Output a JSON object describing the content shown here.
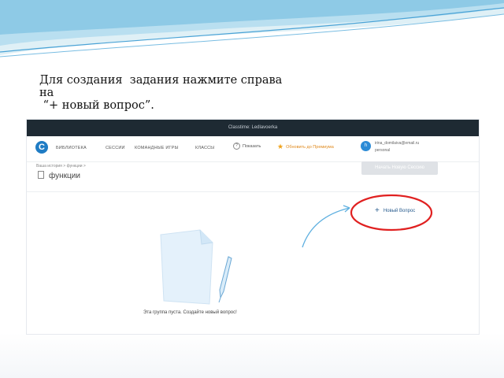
{
  "slide": {
    "caption_line1": "Для создания  задания нажмите справа",
    "caption_line2": "на",
    "caption_line3": " “+ новый вопрос”."
  },
  "screenshot": {
    "window_title": "Classtime: Ledlavoerka",
    "nav": {
      "items": [
        "БИБЛИОТЕКА",
        "СЕССИИ",
        "КОМАНДНЫЕ ИГРЫ",
        "КЛАССЫ"
      ],
      "tour_label": "Показать",
      "premium_label": "Обновить до Премиума",
      "avatar_letter": "h",
      "email": "irina_domilaiva@email.ru",
      "role": "personal"
    },
    "breadcrumb": "Ваша история  >  функции  >",
    "page_title": "функции",
    "start_session_label": "Начать Новую Сессию",
    "new_question_label": "Новый Вопрос",
    "empty_state_text": "Эта группа пуста. Создайте новый вопрос!"
  },
  "colors": {
    "accent_blue": "#1f7cc4",
    "highlight_ring": "#e02020",
    "premium_orange": "#e08a1e",
    "title_bar": "#1e2a33"
  },
  "icons": {
    "logo": "classtime-logo-icon",
    "tour": "question-circle-icon",
    "premium": "star-icon",
    "page": "document-icon",
    "new_question": "plus-icon",
    "illustration": "paper-pen-icon"
  }
}
